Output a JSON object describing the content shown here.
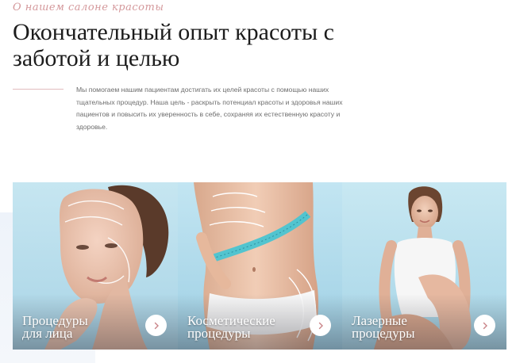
{
  "header": {
    "eyebrow": "О нашем салоне красоты",
    "title": "Окончательный опыт красоты с заботой и целью",
    "description": "Мы помогаем нашим пациентам достигать их целей красоты с помощью наших тщательных процедур. Наша цель - раскрыть потенциал красоты и здоровья наших пациентов и повысить их уверенность в себе, сохраняя их естественную красоту и здоровье."
  },
  "colors": {
    "accent": "#d4989b",
    "heading": "#1c1c1c",
    "body_text": "#6d6d6d",
    "card_sky": "#bfe3f0"
  },
  "cards": [
    {
      "label_line1": "Процедуры",
      "label_line2": "для лица",
      "icon": "chevron-right-icon"
    },
    {
      "label_line1": "Косметические",
      "label_line2": "процедуры",
      "icon": "chevron-right-icon"
    },
    {
      "label_line1": "Лазерные",
      "label_line2": "процедуры",
      "icon": "chevron-right-icon"
    }
  ]
}
